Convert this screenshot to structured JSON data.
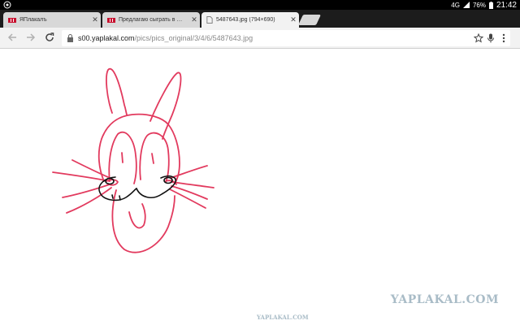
{
  "status_bar": {
    "network": "4G",
    "battery": "76%",
    "time": "21:42"
  },
  "tabs": [
    {
      "title": "ЯПлакалъ",
      "active": false
    },
    {
      "title": "Предлагаю сыграть в небо",
      "active": false
    },
    {
      "title": "5487643.jpg (794×690)",
      "active": true
    }
  ],
  "toolbar": {
    "url_domain": "s00.yaplakal.com",
    "url_path": "/pics/pics_original/3/4/6/5487643.jpg"
  },
  "page": {
    "watermark_large": "YAPLAKAL.COM",
    "watermark_small": "YAPLAKAL.COM",
    "image_alt": "hand-drawn rabbit face sketch"
  },
  "colors": {
    "sketch_pink": "#e23a5e",
    "sketch_black": "#111111",
    "watermark": "#a9bcc7",
    "favicon_red": "#c8102e"
  }
}
